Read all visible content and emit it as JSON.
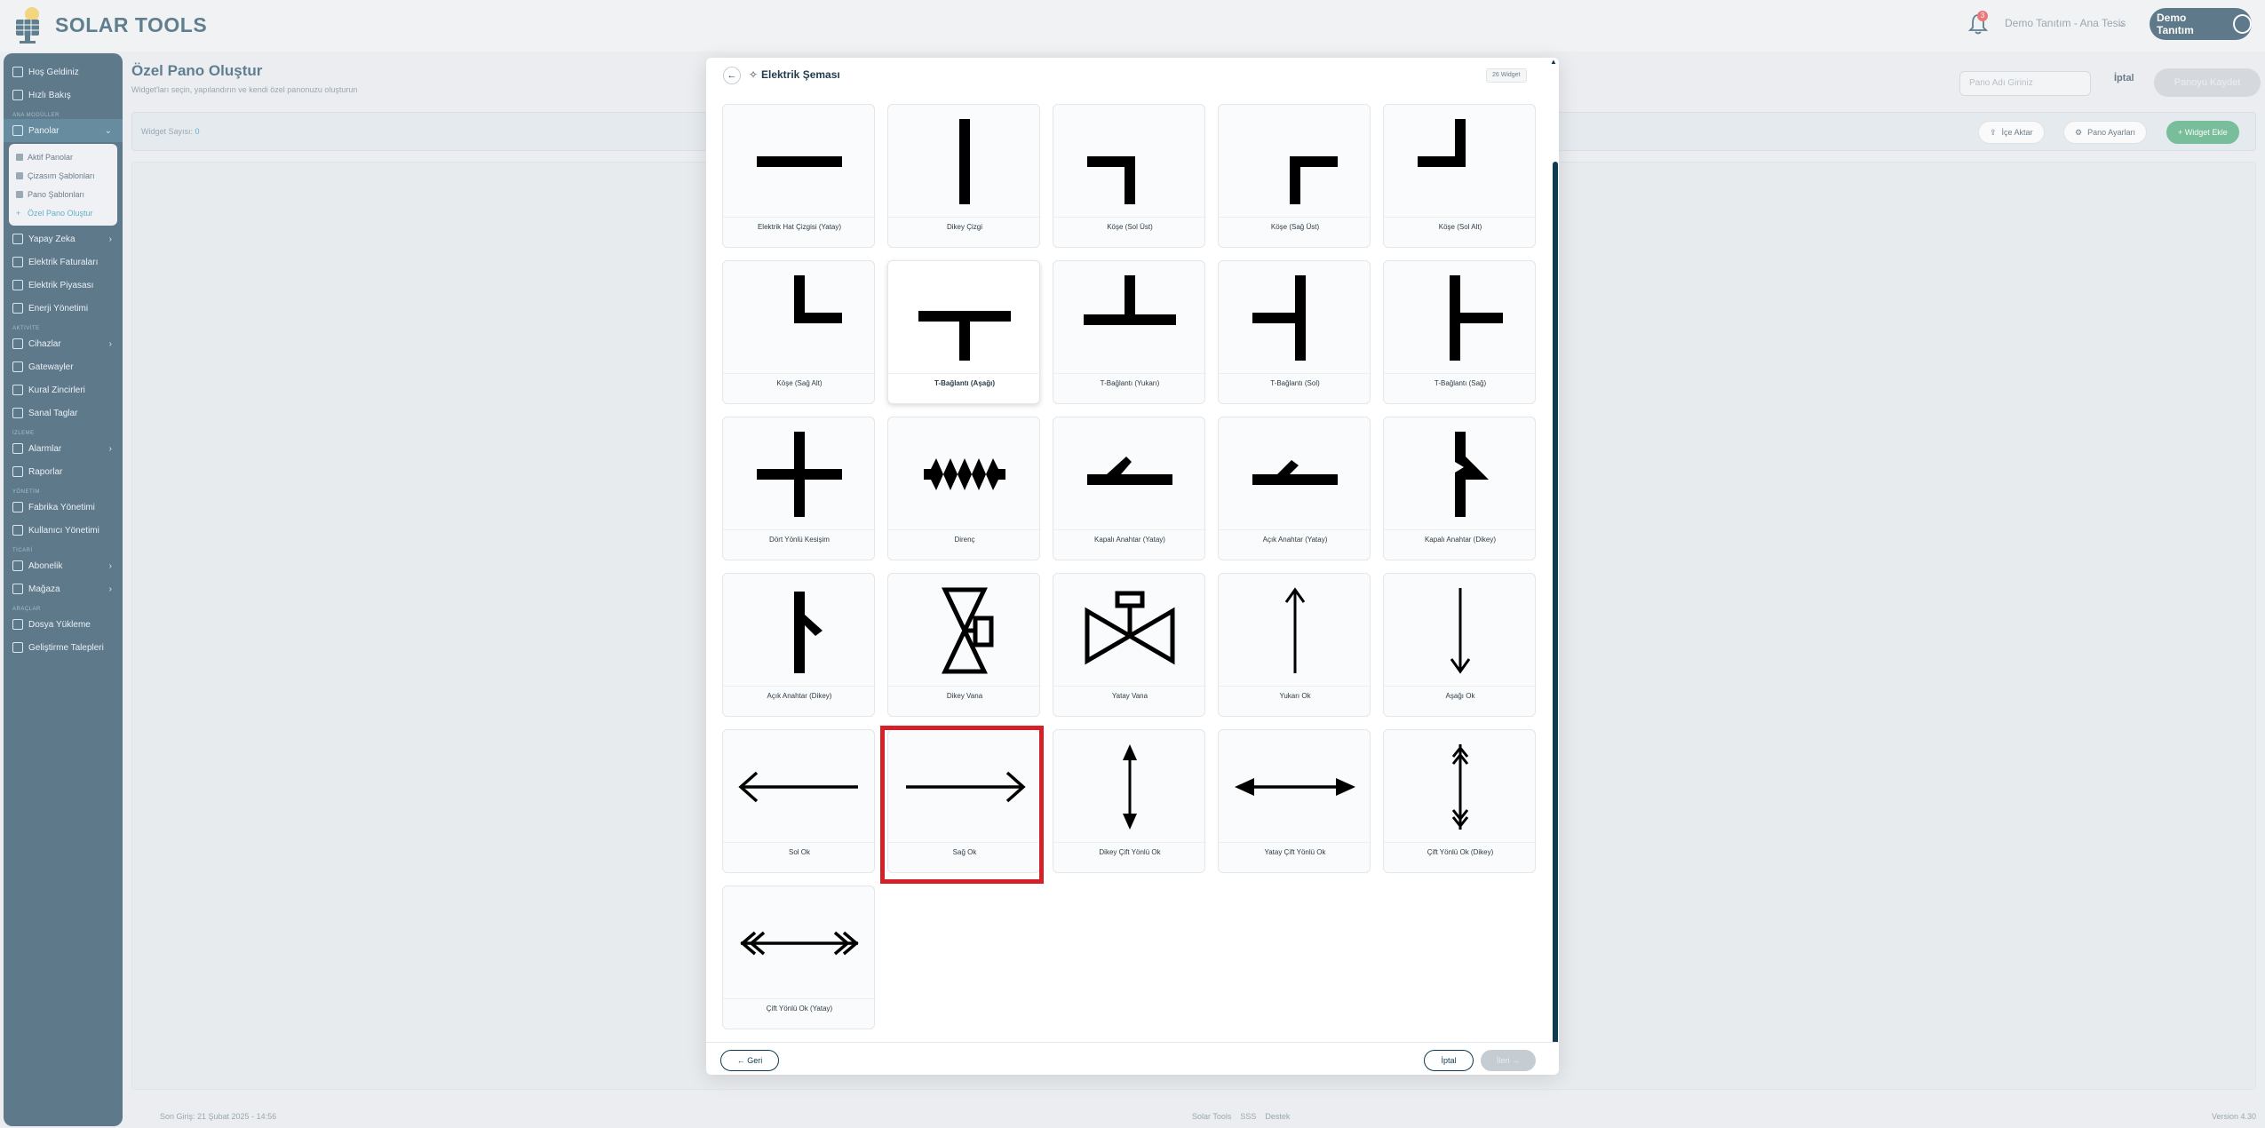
{
  "app": {
    "title": "SOLAR TOOLS"
  },
  "header": {
    "notification_count": "3",
    "tenant": "Demo Tanıtım - Ana Tesis",
    "user": "Demo Tanıtım"
  },
  "sidebar": {
    "items_top": [
      "Hoş Geldiniz",
      "Hızlı Bakış"
    ],
    "section_main": "ANA MODÜLLER",
    "panolar": "Panolar",
    "panolar_sub": [
      "Aktif Panolar",
      "Çizasım Şablonları",
      "Pano Şablonları",
      "Özel Pano Oluştur"
    ],
    "items_main": [
      "Yapay Zeka",
      "Elektrik Faturaları",
      "Elektrik Piyasası",
      "Enerji Yönetimi"
    ],
    "section_devices": "AKTİVİTE",
    "items_devices": [
      "Cihazlar",
      "Gatewayler",
      "Kural Zincirleri",
      "Sanal Taglar"
    ],
    "section_monitor": "İZLEME",
    "items_monitor": [
      "Alarmlar",
      "Raporlar"
    ],
    "section_admin": "YÖNETİM",
    "items_admin": [
      "Fabrika Yönetimi",
      "Kullanıcı Yönetimi"
    ],
    "section_commerce": "TİCARİ",
    "items_commerce": [
      "Abonelik",
      "Mağaza"
    ],
    "section_tools": "ARAÇLAR",
    "items_tools": [
      "Dosya Yükleme",
      "Geliştirme Talepleri"
    ]
  },
  "page": {
    "title": "Özel Pano Oluştur",
    "subtitle": "Widget'ları seçin, yapılandırın ve kendi özel panonuzu oluşturun",
    "name_placeholder": "Pano Adı Giriniz",
    "cancel": "İptal",
    "save": "Panoyu Kaydet",
    "widget_count_label": "Widget Sayısı:",
    "widget_count": "0",
    "import": "İçe Aktar",
    "settings": "Pano Ayarları",
    "add_widget": "+ Widget Ekle"
  },
  "footer": {
    "last_login": "Son Giriş: 21 Şubat 2025 - 14:56",
    "links": [
      "Solar Tools",
      "SSS",
      "Destek"
    ],
    "version": "Version 4.30"
  },
  "modal": {
    "back_icon": "←",
    "title": "Elektrik Şeması",
    "badge": "26 Widget",
    "back_button": "← Geri",
    "cancel_button": "İptal",
    "next_button": "İleri →",
    "widgets": [
      {
        "label": "Elektrik Hat Çizgisi (Yatay)",
        "icon": "horizontal-line"
      },
      {
        "label": "Dikey Çizgi",
        "icon": "vertical-line"
      },
      {
        "label": "Köşe (Sol Üst)",
        "icon": "corner-top-left"
      },
      {
        "label": "Köşe (Sağ Üst)",
        "icon": "corner-top-right"
      },
      {
        "label": "Köşe (Sol Alt)",
        "icon": "corner-bottom-left"
      },
      {
        "label": "Köşe (Sağ Alt)",
        "icon": "corner-bottom-right"
      },
      {
        "label": "T-Bağlantı (Aşağı)",
        "icon": "t-down"
      },
      {
        "label": "T-Bağlantı (Yukarı)",
        "icon": "t-up"
      },
      {
        "label": "T-Bağlantı (Sol)",
        "icon": "t-left"
      },
      {
        "label": "T-Bağlantı (Sağ)",
        "icon": "t-right"
      },
      {
        "label": "Dört Yönlü Kesişim",
        "icon": "cross"
      },
      {
        "label": "Direnç",
        "icon": "resistor"
      },
      {
        "label": "Kapalı Anahtar (Yatay)",
        "icon": "switch-closed-h"
      },
      {
        "label": "Açık Anahtar (Yatay)",
        "icon": "switch-open-h"
      },
      {
        "label": "Kapalı Anahtar (Dikey)",
        "icon": "switch-closed-v"
      },
      {
        "label": "Açık Anahtar (Dikey)",
        "icon": "switch-open-v"
      },
      {
        "label": "Dikey Vana",
        "icon": "valve-v"
      },
      {
        "label": "Yatay Vana",
        "icon": "valve-h"
      },
      {
        "label": "Yukarı Ok",
        "icon": "arrow-up"
      },
      {
        "label": "Aşağı Ok",
        "icon": "arrow-down"
      },
      {
        "label": "Sol Ok",
        "icon": "arrow-left"
      },
      {
        "label": "Sağ Ok",
        "icon": "arrow-right"
      },
      {
        "label": "Dikey Çift Yönlü Ok",
        "icon": "arrow-both-v"
      },
      {
        "label": "Yatay Çift Yönlü Ok",
        "icon": "arrow-both-h"
      },
      {
        "label": "Çift Yönlü Ok (Dikey)",
        "icon": "double-arrow-v"
      },
      {
        "label": "Çift Yönlü Ok (Yatay)",
        "icon": "double-arrow-h"
      }
    ]
  },
  "colors": {
    "brand": "#0e3a52",
    "accent": "#1a8fb0",
    "green": "#3aa36b",
    "highlight": "#d42026"
  }
}
